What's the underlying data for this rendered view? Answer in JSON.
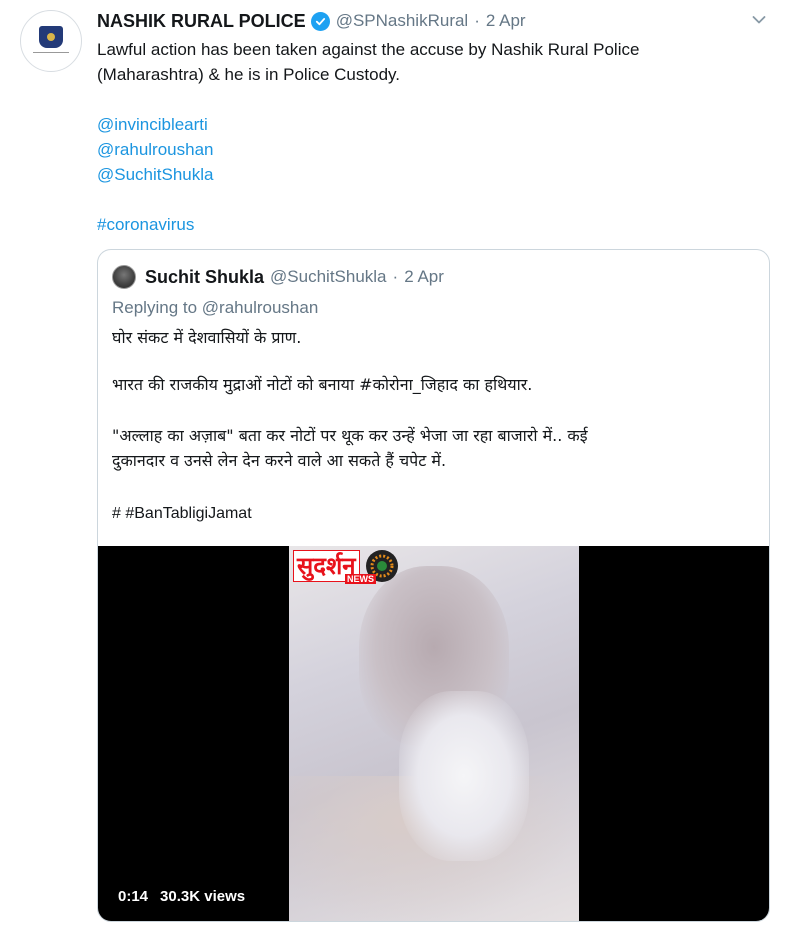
{
  "tweet": {
    "author_name": "NASHIK RURAL POLICE",
    "handle": "@SPNashikRural",
    "separator": "·",
    "date": "2 Apr",
    "body_lines": [
      "Lawful action has been taken against the accuse by Nashik Rural Police",
      "(Maharashtra) & he is in Police Custody."
    ],
    "mentions": [
      "@invinciblearti",
      "@rahulroushan",
      "@SuchitShukla"
    ],
    "hashtag": "#coronavirus"
  },
  "quoted": {
    "author_name": "Suchit Shukla",
    "handle": "@SuchitShukla",
    "separator": "·",
    "date": "2 Apr",
    "replying_prefix": "Replying to",
    "replying_handle": "@rahulroushan",
    "lines": [
      "घोर संकट में देशवासियों के प्राण.",
      "भारत की राजकीय मुद्राओं नोटों को बनाया #कोरोना_जिहाद का हथियार.",
      "\"अल्लाह का अज़ाब\" बता कर नोटों पर थूक कर उन्हें भेजा जा रहा बाजारो में.. कई",
      "दुकानदार व उनसे लेन देन करने वाले आ सकते हैं चपेट में.",
      "# #BanTabligiJamat"
    ],
    "video": {
      "logo_text": "सुदर्शन",
      "logo_sub": "NEWS",
      "duration": "0:14",
      "views": "30.3K views"
    }
  },
  "colors": {
    "link": "#1b95e0",
    "secondary_text": "#657786",
    "verified": "#1da1f2",
    "border": "#ccd6dd"
  },
  "icons": [
    "verified-badge-icon",
    "chevron-down-icon",
    "police-emblem-icon"
  ]
}
